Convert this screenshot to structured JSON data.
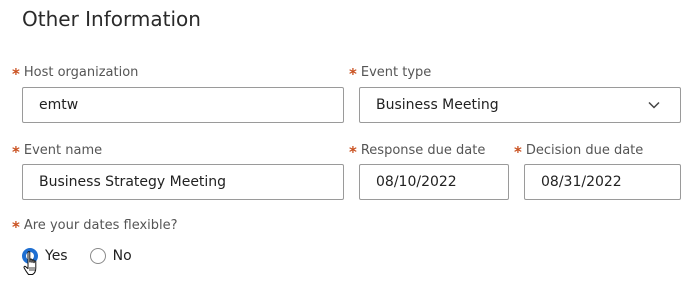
{
  "section": {
    "title": "Other Information"
  },
  "required_marker": "*",
  "fields": {
    "host_organization": {
      "label": "Host organization",
      "value": "emtw"
    },
    "event_type": {
      "label": "Event type",
      "value": "Business Meeting"
    },
    "event_name": {
      "label": "Event name",
      "value": "Business Strategy Meeting"
    },
    "response_due_date": {
      "label": "Response due date",
      "value": "08/10/2022"
    },
    "decision_due_date": {
      "label": "Decision due date",
      "value": "08/31/2022"
    }
  },
  "dates_flexible": {
    "label": "Are your dates flexible?",
    "options": [
      {
        "label": "Yes",
        "selected": true
      },
      {
        "label": "No",
        "selected": false
      }
    ]
  },
  "colors": {
    "required": "#c9501f",
    "radio_selected": "#1f6fd1",
    "border": "#9a9a9a"
  },
  "icons": {
    "select_chevron": "chevron-down-icon",
    "pointer": "hand-pointer-cursor-icon"
  }
}
